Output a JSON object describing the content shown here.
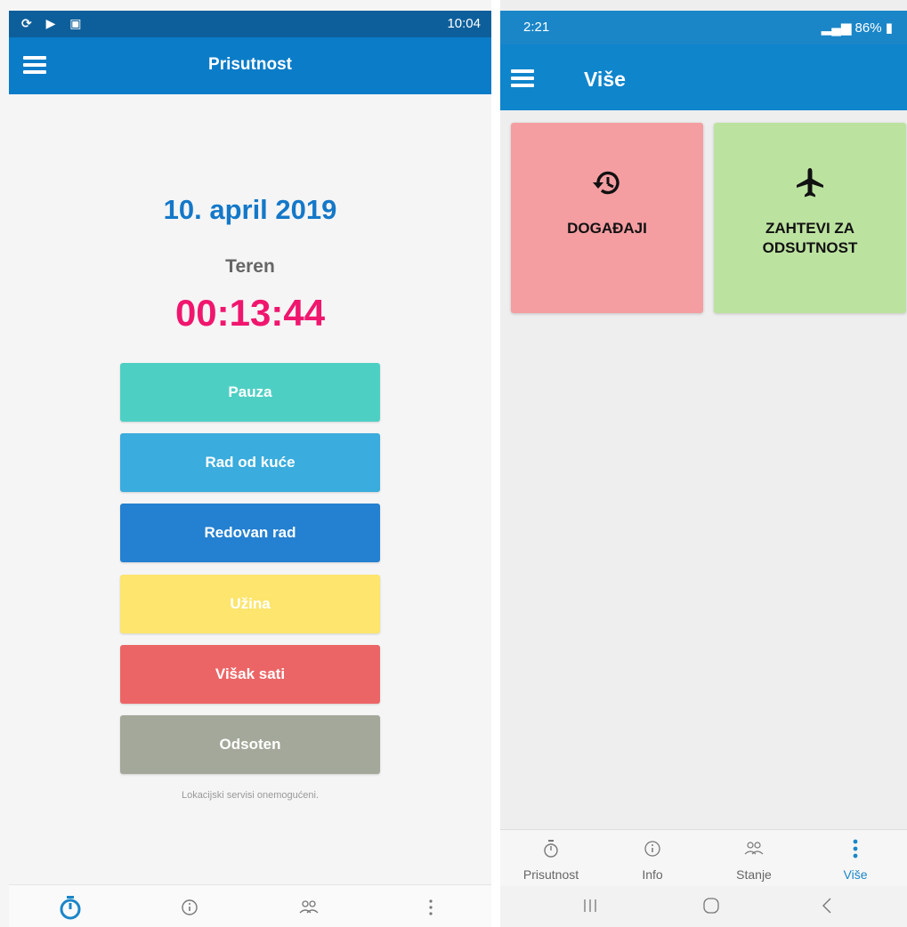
{
  "colors": {
    "appbar": "#0a7cc8",
    "date": "#1478c8",
    "timer": "#f0166e",
    "pauza": "#4ecfc4",
    "rad_od_kuce": "#3aacdd",
    "redovan_rad": "#2480d0",
    "uzina": "#fde56e",
    "visak_sati": "#ec6566",
    "odsoten": "#a3a89a",
    "tile_dogadjaji": "#f49ea2",
    "tile_zahtevi": "#bce2a0",
    "active_nav": "#1a86c8"
  },
  "left": {
    "status_time": "10:04",
    "title": "Prisutnost",
    "date": "10. april 2019",
    "status_label": "Teren",
    "timer": "00:13:44",
    "actions": [
      {
        "label": "Pauza"
      },
      {
        "label": "Rad od kuće"
      },
      {
        "label": "Redovan rad"
      },
      {
        "label": "Užina"
      },
      {
        "label": "Višak sati"
      },
      {
        "label": "Odsoten"
      }
    ],
    "location_note": "Lokacijski servisi onemogućeni.",
    "nav_icons": [
      "stopwatch-icon",
      "info-icon",
      "people-icon",
      "more-icon"
    ]
  },
  "right": {
    "status_time": "2:21",
    "status_battery": "86%",
    "title": "Više",
    "tiles": [
      {
        "label": "DOGAĐAJI",
        "icon": "history-icon"
      },
      {
        "label": "ZAHTEVI ZA ODSUTNOST",
        "icon": "airplane-icon"
      }
    ],
    "nav": [
      {
        "label": "Prisutnost",
        "icon": "stopwatch-icon"
      },
      {
        "label": "Info",
        "icon": "info-icon"
      },
      {
        "label": "Stanje",
        "icon": "people-icon"
      },
      {
        "label": "Više",
        "icon": "more-icon"
      }
    ],
    "system_nav": [
      "recent-apps-icon",
      "home-icon",
      "back-icon"
    ]
  }
}
